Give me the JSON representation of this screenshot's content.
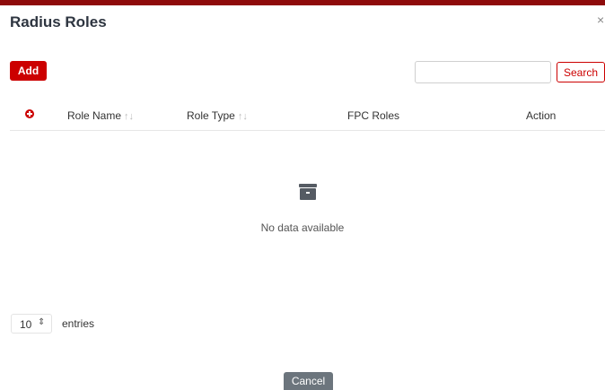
{
  "colors": {
    "accent": "#cc0000",
    "top_bar": "#8e0b0b",
    "cancel": "#6c757d"
  },
  "modal": {
    "title": "Radius Roles",
    "close_label": "×"
  },
  "toolbar": {
    "add_label": "Add",
    "search_placeholder": "",
    "search_value": "",
    "search_label": "Search"
  },
  "table": {
    "columns": [
      {
        "label": "",
        "icon": "plus-circle-icon"
      },
      {
        "label": "Role Name",
        "sort": "↑↓"
      },
      {
        "label": "Role Type",
        "sort": "↑↓"
      },
      {
        "label": "FPC Roles"
      },
      {
        "label": "Action"
      }
    ],
    "rows": [],
    "empty_icon": "archive-icon",
    "empty_message": "No data available"
  },
  "pagination": {
    "page_length": "10",
    "entries_label": "entries"
  },
  "footer": {
    "cancel_label": "Cancel"
  }
}
